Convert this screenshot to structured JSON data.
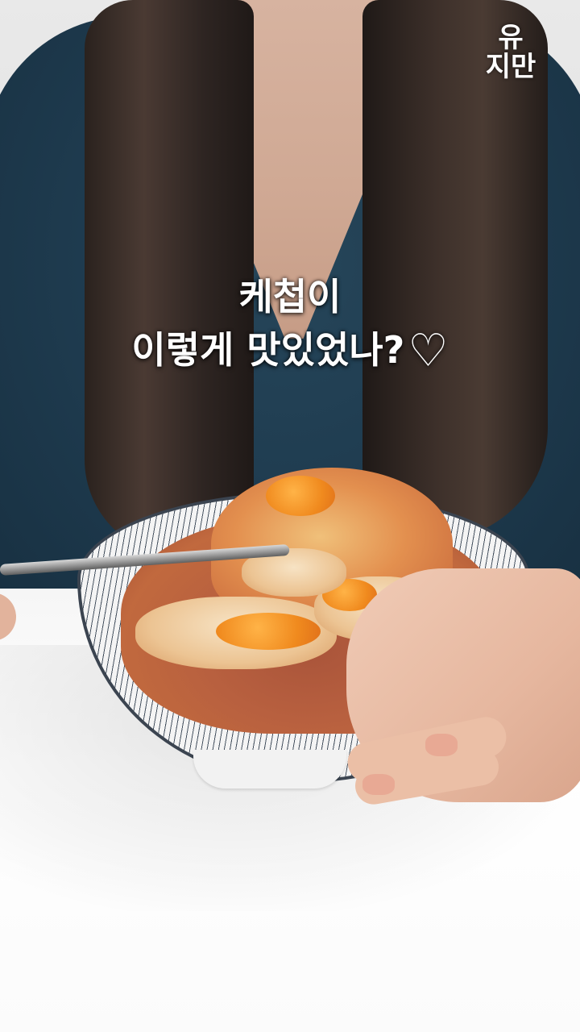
{
  "caption": {
    "line1": "케첩이",
    "line2": "이렇게 맛있었나?",
    "heart_icon": "white-heart-icon"
  },
  "logo": {
    "line1": "유",
    "line2": "지만"
  }
}
